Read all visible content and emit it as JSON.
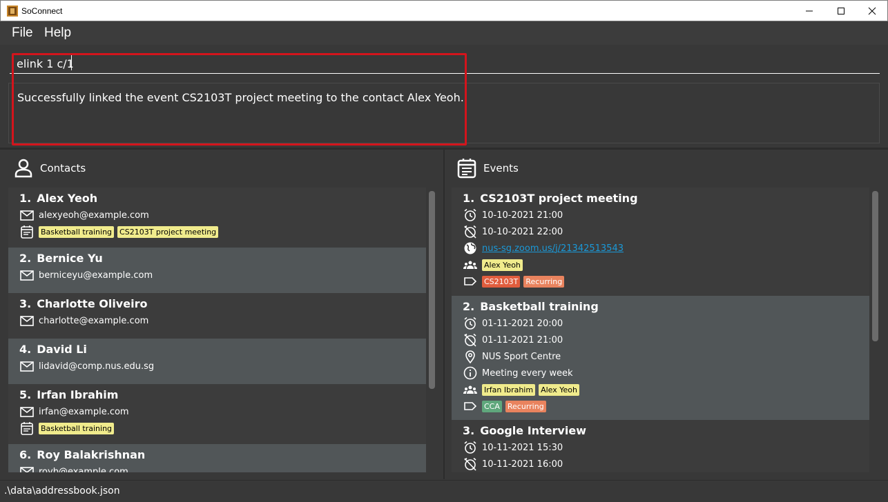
{
  "window": {
    "title": "SoConnect"
  },
  "menu": {
    "file": "File",
    "help": "Help"
  },
  "command": {
    "value": "elink 1 c/1"
  },
  "result": {
    "text": "Successfully linked the event CS2103T project meeting to the contact Alex Yeoh."
  },
  "contacts_panel": {
    "title": "Contacts",
    "contacts": [
      {
        "index": "1.",
        "name": "Alex Yeoh",
        "email": "alexyeoh@example.com",
        "events": [
          "Basketball training",
          "CS2103T project meeting"
        ]
      },
      {
        "index": "2.",
        "name": "Bernice Yu",
        "email": "berniceyu@example.com",
        "events": []
      },
      {
        "index": "3.",
        "name": "Charlotte Oliveiro",
        "email": "charlotte@example.com",
        "events": []
      },
      {
        "index": "4.",
        "name": "David Li",
        "email": "lidavid@comp.nus.edu.sg",
        "events": []
      },
      {
        "index": "5.",
        "name": "Irfan Ibrahim",
        "email": "irfan@example.com",
        "events": [
          "Basketball training"
        ]
      },
      {
        "index": "6.",
        "name": "Roy Balakrishnan",
        "email": "royb@example.com",
        "events": []
      }
    ]
  },
  "events_panel": {
    "title": "Events",
    "events": [
      {
        "index": "1.",
        "name": "CS2103T project meeting",
        "start": "10-10-2021 21:00",
        "end": "10-10-2021 22:00",
        "zoom": "nus-sg.zoom.us/j/21342513543",
        "contacts": [
          "Alex Yeoh"
        ],
        "tags": [
          "CS2103T",
          "Recurring"
        ]
      },
      {
        "index": "2.",
        "name": "Basketball training",
        "start": "01-11-2021 20:00",
        "end": "01-11-2021 21:00",
        "address": "NUS Sport Centre",
        "description": "Meeting every week",
        "contacts": [
          "Irfan Ibrahim",
          "Alex Yeoh"
        ],
        "tags": [
          "CCA",
          "Recurring"
        ]
      },
      {
        "index": "3.",
        "name": "Google Interview",
        "start": "10-11-2021 15:30",
        "end": "10-11-2021 16:00"
      }
    ]
  },
  "status": {
    "path": ".\\data\\addressbook.json"
  },
  "colors": {
    "highlight": "#d4141c",
    "tag_contact": "#f0eb8c",
    "tag_cs2103t": "#e05d3e",
    "tag_recurring": "#e9835e",
    "tag_cca": "#5fa77c",
    "link": "#1a99d8"
  },
  "icons": [
    "person-icon",
    "calendar-icon",
    "mail-icon",
    "alarm-icon",
    "alarm-off-icon",
    "globe-icon",
    "group-icon",
    "tag-icon",
    "location-icon",
    "info-icon"
  ]
}
